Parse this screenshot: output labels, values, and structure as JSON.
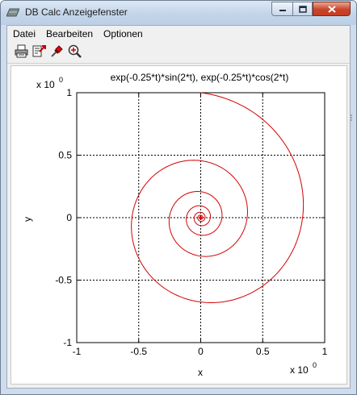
{
  "window": {
    "title": "DB Calc Anzeigefenster",
    "controls": {
      "minimize": "minimize",
      "maximize": "maximize",
      "close": "close"
    }
  },
  "menu": {
    "items": [
      "Datei",
      "Bearbeiten",
      "Optionen"
    ]
  },
  "toolbar": {
    "buttons": [
      "printer-icon",
      "export-icon",
      "pin-icon",
      "zoom-icon"
    ]
  },
  "chart_data": {
    "type": "line",
    "title": "exp(-0.25*t)*sin(2*t), exp(-0.25*t)*cos(2*t)",
    "xlabel": "x",
    "ylabel": "y",
    "x_multiplier": "x 10",
    "x_multiplier_exp": "0",
    "y_multiplier": "x 10",
    "y_multiplier_exp": "0",
    "xlim": [
      -1,
      1
    ],
    "ylim": [
      -1,
      1
    ],
    "xticks": [
      "-1",
      "-0.5",
      "0",
      "0.5",
      "1"
    ],
    "yticks": [
      "1",
      "0.5",
      "0",
      "-0.5",
      "-1"
    ],
    "grid": true,
    "series": [
      {
        "color": "#d40000",
        "parametric": {
          "x": "exp(-0.25*t)*sin(2*t)",
          "y": "exp(-0.25*t)*cos(2*t)"
        },
        "t_range": [
          0,
          30
        ],
        "x": [
          0,
          0.3829,
          0.6955,
          0.8812,
          0.9093,
          0.7794,
          0.5204,
          0.1843,
          -0.1633,
          -0.4552,
          -0.6384,
          -0.6825,
          -0.5853,
          -0.3728,
          -0.0925,
          0.1958,
          0.4264,
          0.5562,
          0.5619,
          0.446,
          0.2335,
          -0.037,
          -0.29
        ],
        "y": [
          1,
          0.8574,
          0.516,
          0.1025,
          -0.2844,
          -0.5654,
          -0.6993,
          -0.6732,
          -0.5015,
          -0.2258,
          0.0851,
          0.3531,
          0.5171,
          0.5467,
          0.4423,
          0.2354,
          -0.0195,
          -0.2543,
          -0.4113,
          -0.454,
          -0.3808,
          -0.2203,
          -0.0195
        ]
      }
    ]
  }
}
